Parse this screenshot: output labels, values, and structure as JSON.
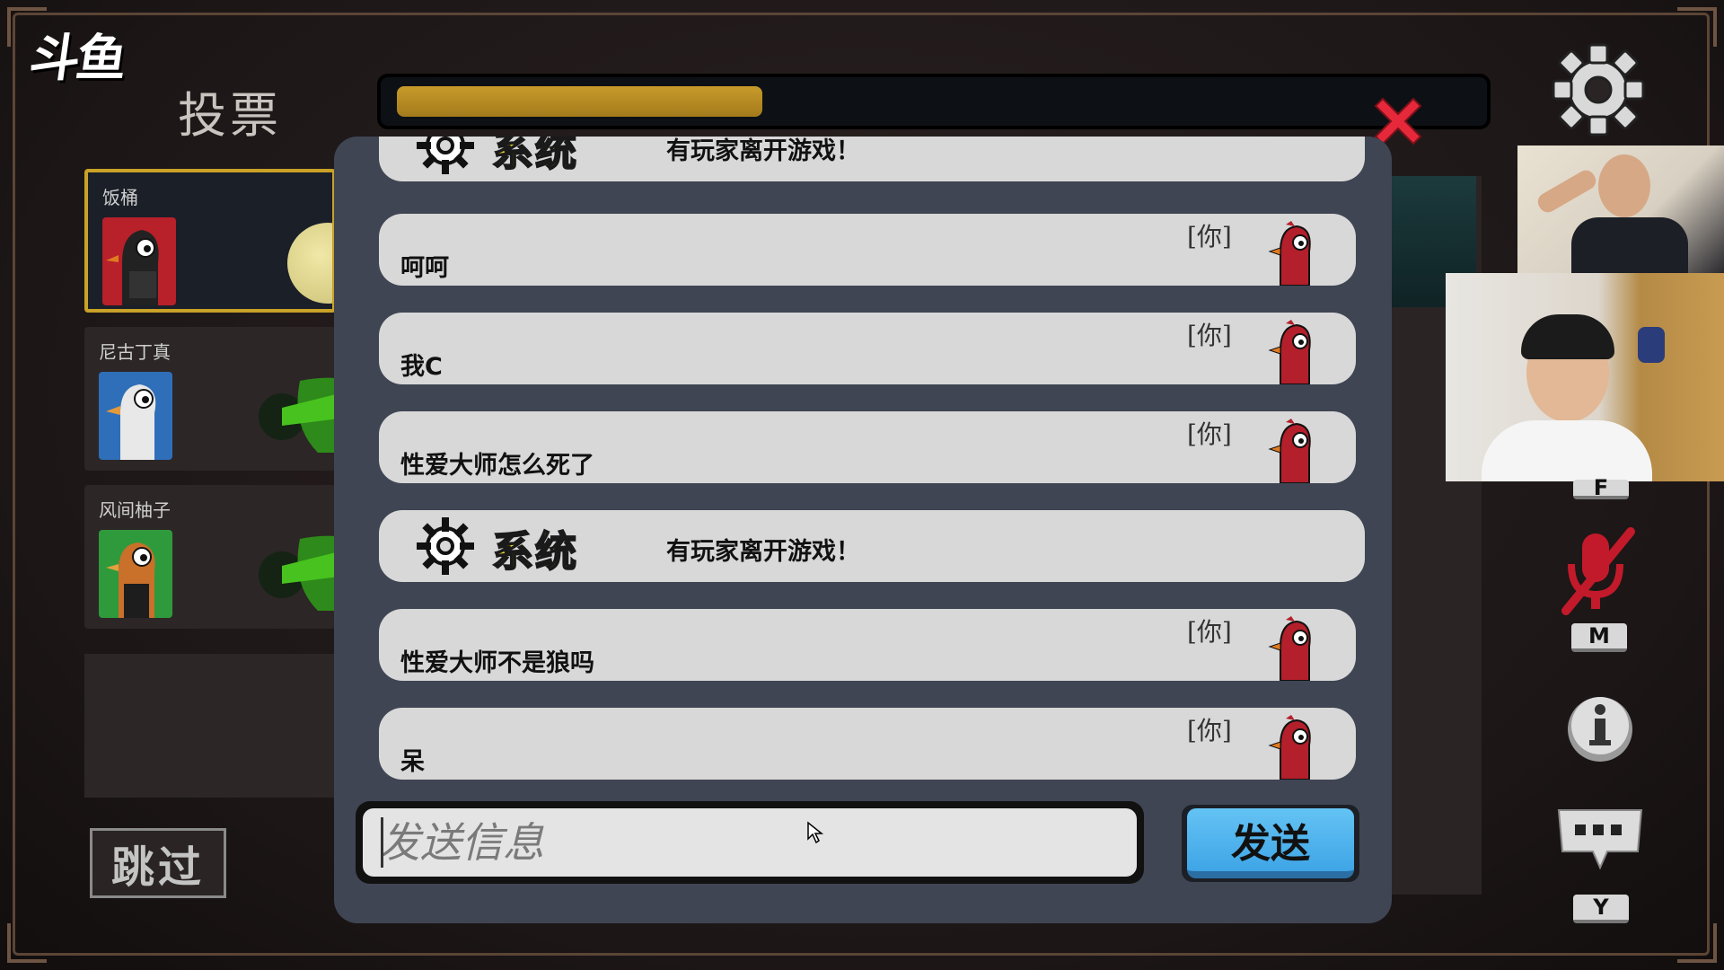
{
  "app": {
    "logo_text": "斗鱼"
  },
  "header": {
    "title": "投票"
  },
  "timer": {
    "progress_fraction": 0.34,
    "color": "#c79a2a"
  },
  "players": [
    {
      "name": "饭桶",
      "selected": true,
      "avatar_color": "#b8202a"
    },
    {
      "name": "尼古丁真",
      "selected": false,
      "avatar_color": "#2f6fb9"
    },
    {
      "name": "风间柚子",
      "selected": false,
      "avatar_color": "#2e9a3c"
    }
  ],
  "skip_button": {
    "label": "跳过"
  },
  "chat": {
    "messages": [
      {
        "type": "system",
        "label": "系统",
        "text": "有玩家离开游戏！"
      },
      {
        "type": "player",
        "tag": "[你]",
        "text": "呵呵"
      },
      {
        "type": "player",
        "tag": "[你]",
        "text": "我C"
      },
      {
        "type": "player",
        "tag": "[你]",
        "text": "性爱大师怎么死了"
      },
      {
        "type": "system",
        "label": "系统",
        "text": "有玩家离开游戏！"
      },
      {
        "type": "player",
        "tag": "[你]",
        "text": "性爱大师不是狼吗"
      },
      {
        "type": "player",
        "tag": "[你]",
        "text": "呆"
      }
    ],
    "input": {
      "placeholder": "发送信息",
      "value": ""
    },
    "send_label": "发送",
    "accent_color": "#e8d32a"
  },
  "right_panel": {
    "mute_key": "M",
    "chat_key": "Y",
    "partial_key": "F"
  },
  "icons": {
    "close": "close-icon",
    "settings": "gear-icon",
    "mic_muted": "mic-muted-icon",
    "info": "info-icon",
    "chat": "chat-bubble-icon"
  }
}
